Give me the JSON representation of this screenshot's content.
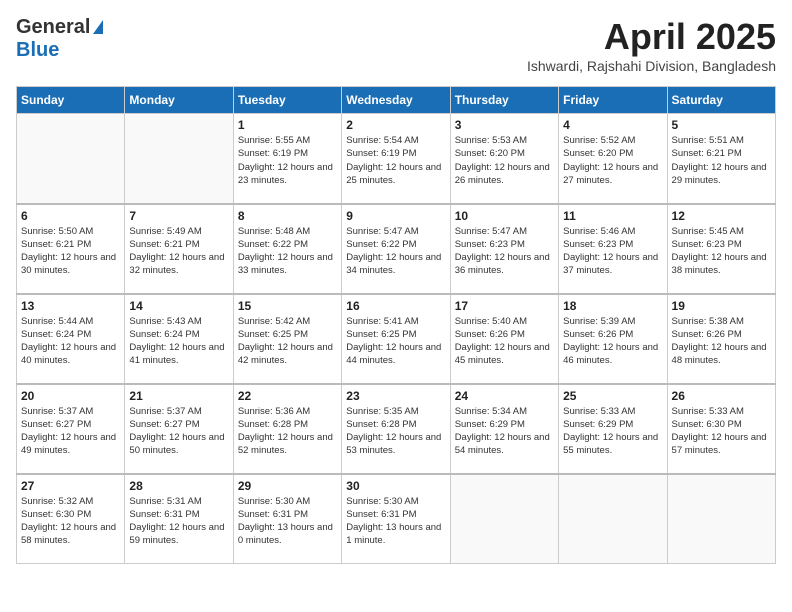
{
  "header": {
    "logo_general": "General",
    "logo_blue": "Blue",
    "month_year": "April 2025",
    "location": "Ishwardi, Rajshahi Division, Bangladesh"
  },
  "days_of_week": [
    "Sunday",
    "Monday",
    "Tuesday",
    "Wednesday",
    "Thursday",
    "Friday",
    "Saturday"
  ],
  "weeks": [
    [
      {
        "day": "",
        "sunrise": "",
        "sunset": "",
        "daylight": ""
      },
      {
        "day": "",
        "sunrise": "",
        "sunset": "",
        "daylight": ""
      },
      {
        "day": "1",
        "sunrise": "Sunrise: 5:55 AM",
        "sunset": "Sunset: 6:19 PM",
        "daylight": "Daylight: 12 hours and 23 minutes."
      },
      {
        "day": "2",
        "sunrise": "Sunrise: 5:54 AM",
        "sunset": "Sunset: 6:19 PM",
        "daylight": "Daylight: 12 hours and 25 minutes."
      },
      {
        "day": "3",
        "sunrise": "Sunrise: 5:53 AM",
        "sunset": "Sunset: 6:20 PM",
        "daylight": "Daylight: 12 hours and 26 minutes."
      },
      {
        "day": "4",
        "sunrise": "Sunrise: 5:52 AM",
        "sunset": "Sunset: 6:20 PM",
        "daylight": "Daylight: 12 hours and 27 minutes."
      },
      {
        "day": "5",
        "sunrise": "Sunrise: 5:51 AM",
        "sunset": "Sunset: 6:21 PM",
        "daylight": "Daylight: 12 hours and 29 minutes."
      }
    ],
    [
      {
        "day": "6",
        "sunrise": "Sunrise: 5:50 AM",
        "sunset": "Sunset: 6:21 PM",
        "daylight": "Daylight: 12 hours and 30 minutes."
      },
      {
        "day": "7",
        "sunrise": "Sunrise: 5:49 AM",
        "sunset": "Sunset: 6:21 PM",
        "daylight": "Daylight: 12 hours and 32 minutes."
      },
      {
        "day": "8",
        "sunrise": "Sunrise: 5:48 AM",
        "sunset": "Sunset: 6:22 PM",
        "daylight": "Daylight: 12 hours and 33 minutes."
      },
      {
        "day": "9",
        "sunrise": "Sunrise: 5:47 AM",
        "sunset": "Sunset: 6:22 PM",
        "daylight": "Daylight: 12 hours and 34 minutes."
      },
      {
        "day": "10",
        "sunrise": "Sunrise: 5:47 AM",
        "sunset": "Sunset: 6:23 PM",
        "daylight": "Daylight: 12 hours and 36 minutes."
      },
      {
        "day": "11",
        "sunrise": "Sunrise: 5:46 AM",
        "sunset": "Sunset: 6:23 PM",
        "daylight": "Daylight: 12 hours and 37 minutes."
      },
      {
        "day": "12",
        "sunrise": "Sunrise: 5:45 AM",
        "sunset": "Sunset: 6:23 PM",
        "daylight": "Daylight: 12 hours and 38 minutes."
      }
    ],
    [
      {
        "day": "13",
        "sunrise": "Sunrise: 5:44 AM",
        "sunset": "Sunset: 6:24 PM",
        "daylight": "Daylight: 12 hours and 40 minutes."
      },
      {
        "day": "14",
        "sunrise": "Sunrise: 5:43 AM",
        "sunset": "Sunset: 6:24 PM",
        "daylight": "Daylight: 12 hours and 41 minutes."
      },
      {
        "day": "15",
        "sunrise": "Sunrise: 5:42 AM",
        "sunset": "Sunset: 6:25 PM",
        "daylight": "Daylight: 12 hours and 42 minutes."
      },
      {
        "day": "16",
        "sunrise": "Sunrise: 5:41 AM",
        "sunset": "Sunset: 6:25 PM",
        "daylight": "Daylight: 12 hours and 44 minutes."
      },
      {
        "day": "17",
        "sunrise": "Sunrise: 5:40 AM",
        "sunset": "Sunset: 6:26 PM",
        "daylight": "Daylight: 12 hours and 45 minutes."
      },
      {
        "day": "18",
        "sunrise": "Sunrise: 5:39 AM",
        "sunset": "Sunset: 6:26 PM",
        "daylight": "Daylight: 12 hours and 46 minutes."
      },
      {
        "day": "19",
        "sunrise": "Sunrise: 5:38 AM",
        "sunset": "Sunset: 6:26 PM",
        "daylight": "Daylight: 12 hours and 48 minutes."
      }
    ],
    [
      {
        "day": "20",
        "sunrise": "Sunrise: 5:37 AM",
        "sunset": "Sunset: 6:27 PM",
        "daylight": "Daylight: 12 hours and 49 minutes."
      },
      {
        "day": "21",
        "sunrise": "Sunrise: 5:37 AM",
        "sunset": "Sunset: 6:27 PM",
        "daylight": "Daylight: 12 hours and 50 minutes."
      },
      {
        "day": "22",
        "sunrise": "Sunrise: 5:36 AM",
        "sunset": "Sunset: 6:28 PM",
        "daylight": "Daylight: 12 hours and 52 minutes."
      },
      {
        "day": "23",
        "sunrise": "Sunrise: 5:35 AM",
        "sunset": "Sunset: 6:28 PM",
        "daylight": "Daylight: 12 hours and 53 minutes."
      },
      {
        "day": "24",
        "sunrise": "Sunrise: 5:34 AM",
        "sunset": "Sunset: 6:29 PM",
        "daylight": "Daylight: 12 hours and 54 minutes."
      },
      {
        "day": "25",
        "sunrise": "Sunrise: 5:33 AM",
        "sunset": "Sunset: 6:29 PM",
        "daylight": "Daylight: 12 hours and 55 minutes."
      },
      {
        "day": "26",
        "sunrise": "Sunrise: 5:33 AM",
        "sunset": "Sunset: 6:30 PM",
        "daylight": "Daylight: 12 hours and 57 minutes."
      }
    ],
    [
      {
        "day": "27",
        "sunrise": "Sunrise: 5:32 AM",
        "sunset": "Sunset: 6:30 PM",
        "daylight": "Daylight: 12 hours and 58 minutes."
      },
      {
        "day": "28",
        "sunrise": "Sunrise: 5:31 AM",
        "sunset": "Sunset: 6:31 PM",
        "daylight": "Daylight: 12 hours and 59 minutes."
      },
      {
        "day": "29",
        "sunrise": "Sunrise: 5:30 AM",
        "sunset": "Sunset: 6:31 PM",
        "daylight": "Daylight: 13 hours and 0 minutes."
      },
      {
        "day": "30",
        "sunrise": "Sunrise: 5:30 AM",
        "sunset": "Sunset: 6:31 PM",
        "daylight": "Daylight: 13 hours and 1 minute."
      },
      {
        "day": "",
        "sunrise": "",
        "sunset": "",
        "daylight": ""
      },
      {
        "day": "",
        "sunrise": "",
        "sunset": "",
        "daylight": ""
      },
      {
        "day": "",
        "sunrise": "",
        "sunset": "",
        "daylight": ""
      }
    ]
  ]
}
